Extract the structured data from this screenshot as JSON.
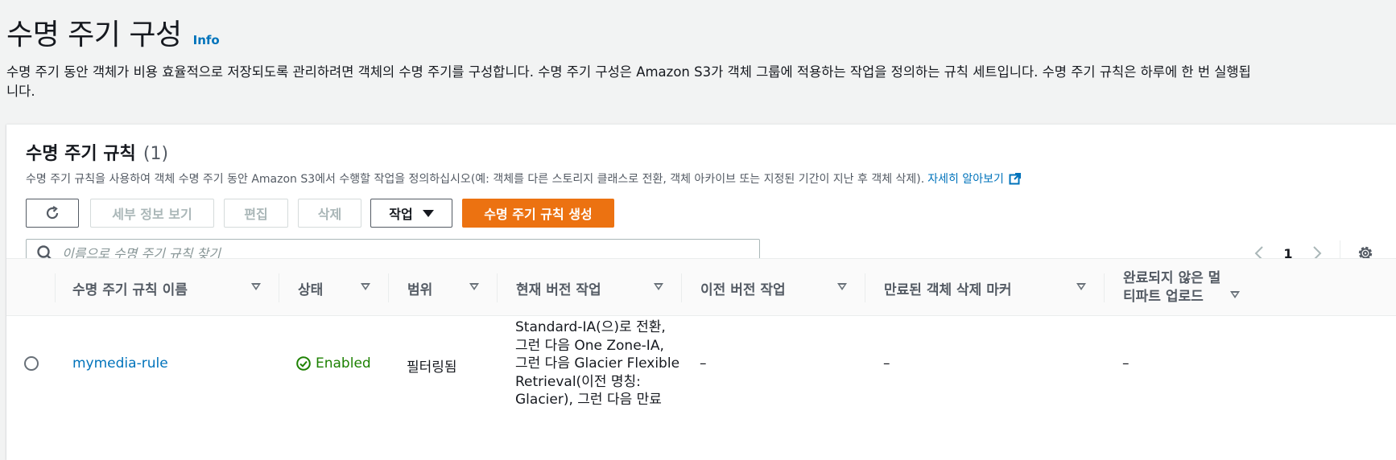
{
  "header": {
    "title": "수명 주기 구성",
    "info": "Info",
    "description_line1": "수명 주기 동안 객체가 비용 효율적으로 저장되도록 관리하려면 객체의 수명 주기를 구성합니다. 수명 주기 구성은 Amazon S3가 객체 그룹에 적용하는 작업을 정의하는 규칙 세트입니다. 수명 주기 규칙은 하루에 한 번 실행됩",
    "description_line2": "니다."
  },
  "rules_panel": {
    "title": "수명 주기 규칙",
    "count": "(1)",
    "description": "수명 주기 규칙을 사용하여 객체 수명 주기 동안 Amazon S3에서 수행할 작업을 정의하십시오(예: 객체를 다른 스토리지 클래스로 전환, 객체 아카이브 또는 지정된 기간이 지난 후 객체 삭제).",
    "learn_more": "자세히 알아보기",
    "learn_more_icon": "external-link-icon"
  },
  "toolbar": {
    "refresh_icon": "refresh-icon",
    "view_details": "세부 정보 보기",
    "edit": "편집",
    "delete": "삭제",
    "actions": "작업",
    "create_rule": "수명 주기 규칙 생성"
  },
  "search": {
    "placeholder": "이름으로 수명 주기 규칙 찾기",
    "value": ""
  },
  "pagination": {
    "current_page": "1",
    "prev_icon": "chevron-left-icon",
    "next_icon": "chevron-right-icon",
    "settings_icon": "gear-icon"
  },
  "table": {
    "columns": [
      "수명 주기 규칙 이름",
      "상태",
      "범위",
      "현재 버전 작업",
      "이전 버전 작업",
      "만료된 객체 삭제 마커",
      "완료되지 않은 멀",
      "티파트 업로드"
    ],
    "rows": [
      {
        "name": "mymedia-rule",
        "status": "Enabled",
        "scope": "필터링됨",
        "current_actions": [
          "Standard-IA(으)로 전환,",
          "그런 다음 One Zone-IA,",
          "그런 다음 Glacier Flexible",
          "Retrieval(이전 명칭:",
          "Glacier), 그런 다음 만료"
        ],
        "noncurrent_actions": "–",
        "expired_delete_markers": "–",
        "incomplete_multipart": "–"
      }
    ]
  },
  "colors": {
    "accent": "#ec7211",
    "link": "#0073bb",
    "success": "#1d8102",
    "background": "#f2f3f3"
  }
}
